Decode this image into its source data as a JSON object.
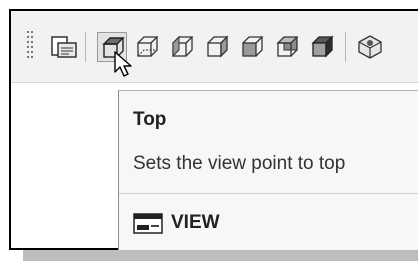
{
  "toolbar": {
    "tools": [
      {
        "name": "named-views-icon"
      },
      {
        "name": "top-view-icon"
      },
      {
        "name": "bottom-view-icon"
      },
      {
        "name": "left-view-icon"
      },
      {
        "name": "right-view-icon"
      },
      {
        "name": "front-view-icon"
      },
      {
        "name": "back-view-icon"
      },
      {
        "name": "camera-view-icon"
      }
    ],
    "hovered": "top-view-icon"
  },
  "tooltip": {
    "title": "Top",
    "description": "Sets the view point to top",
    "command": "VIEW",
    "command_icon": "view-command-icon"
  }
}
